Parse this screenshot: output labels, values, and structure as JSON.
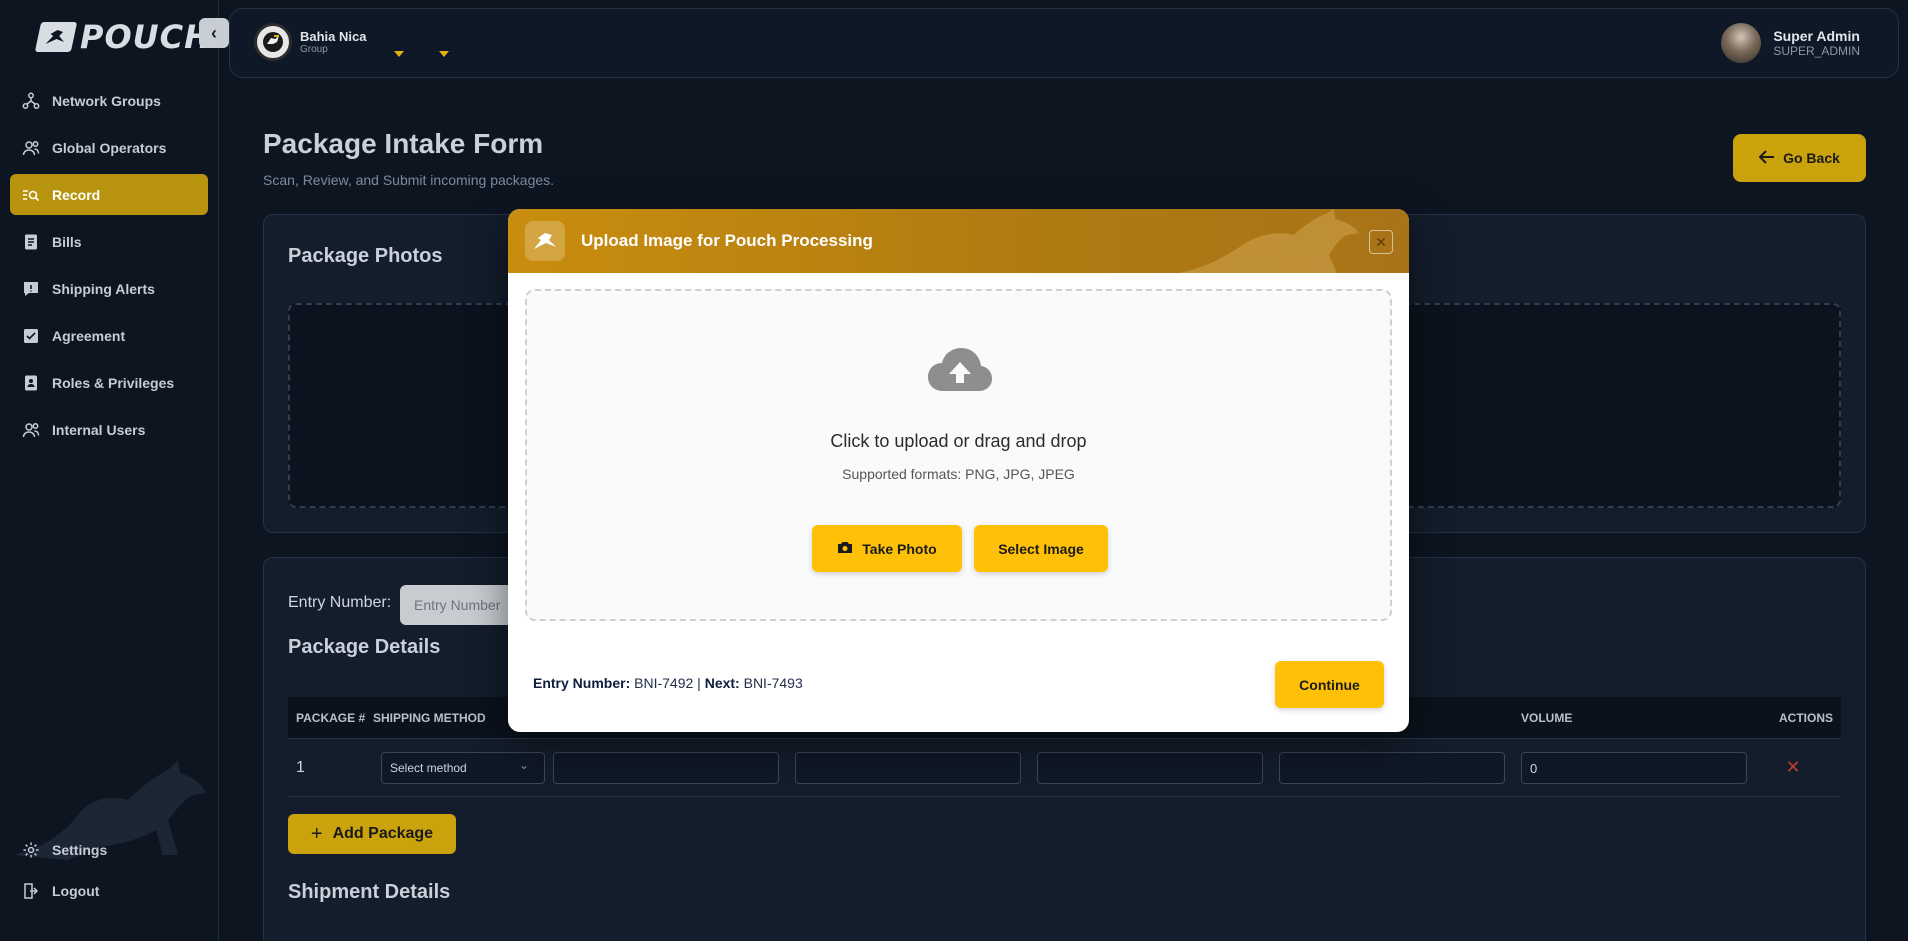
{
  "app": {
    "logo_text": "POUCH"
  },
  "sidebar": {
    "items": [
      {
        "label": "Network Groups",
        "icon": "network-icon"
      },
      {
        "label": "Global Operators",
        "icon": "operators-icon"
      },
      {
        "label": "Record",
        "icon": "record-icon",
        "active": true
      },
      {
        "label": "Bills",
        "icon": "bills-icon"
      },
      {
        "label": "Shipping Alerts",
        "icon": "alert-icon"
      },
      {
        "label": "Agreement",
        "icon": "agreement-icon"
      },
      {
        "label": "Roles & Privileges",
        "icon": "roles-icon"
      },
      {
        "label": "Internal Users",
        "icon": "users-icon"
      }
    ],
    "bottom": [
      {
        "label": "Settings",
        "icon": "gear-icon"
      },
      {
        "label": "Logout",
        "icon": "logout-icon"
      }
    ]
  },
  "topbar": {
    "org_name": "Bahia Nica",
    "org_type": "Group",
    "user_name": "Super Admin",
    "user_role": "SUPER_ADMIN"
  },
  "page": {
    "title": "Package Intake Form",
    "subtitle": "Scan, Review, and Submit incoming packages.",
    "go_back_label": "Go Back",
    "photos_title": "Package Photos",
    "entry_label": "Entry Number:",
    "entry_placeholder": "Entry Number",
    "details_title": "Package Details",
    "shipment_title": "Shipment Details",
    "add_package_label": "Add Package",
    "table": {
      "headers": [
        "PACKAGE #",
        "SHIPPING METHOD",
        "",
        "",
        "",
        "",
        "VOLUME",
        "ACTIONS"
      ],
      "rows": [
        {
          "package_no": "1",
          "shipping_method": "Select method",
          "volume": "0"
        }
      ]
    }
  },
  "modal": {
    "title": "Upload Image for Pouch Processing",
    "upload_text": "Click to upload or drag and drop",
    "formats_text": "Supported formats: PNG, JPG, JPEG",
    "take_photo_label": "Take Photo",
    "select_image_label": "Select Image",
    "continue_label": "Continue",
    "entry_number_label": "Entry Number:",
    "entry_number_value": "BNI-7492",
    "separator": "|",
    "next_label": "Next:",
    "next_value": "BNI-7493"
  },
  "colors": {
    "accent": "#ffc107",
    "accent_dark": "#c9a20c",
    "background": "#0d1521",
    "modal_header": "#c98d0e"
  }
}
